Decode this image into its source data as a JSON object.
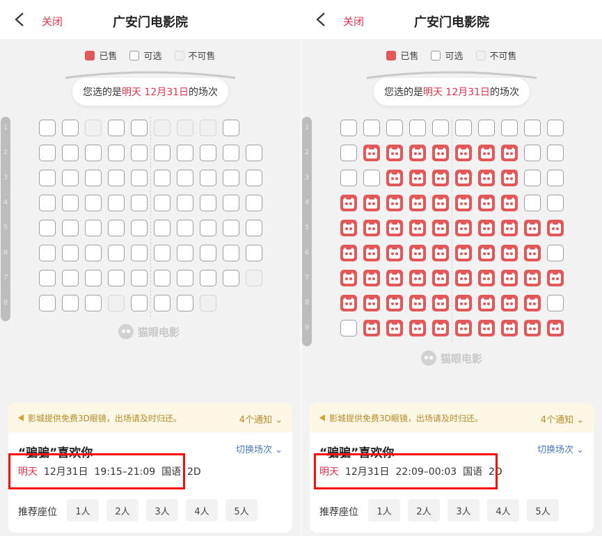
{
  "screens": [
    {
      "nav": {
        "close_label": "关闭",
        "title": "广安门电影院"
      },
      "legend": {
        "sold": "已售",
        "available": "可选",
        "not_for_sale": "不可售"
      },
      "session_pill": {
        "prefix": "您选的是",
        "day": "明天",
        "date": "12月31日",
        "suffix": "的场次"
      },
      "row_numbers": [
        "1",
        "2",
        "3",
        "4",
        "5",
        "6",
        "7",
        "8"
      ],
      "seat_rows": [
        [
          "A",
          "A",
          "N",
          "A",
          "A",
          "N",
          "N",
          "N",
          "A"
        ],
        [
          "A",
          "A",
          "A",
          "A",
          "A",
          "A",
          "A",
          "A",
          "A",
          "A"
        ],
        [
          "A",
          "A",
          "A",
          "A",
          "A",
          "A",
          "A",
          "A",
          "A",
          "A"
        ],
        [
          "A",
          "A",
          "A",
          "A",
          "A",
          "A",
          "A",
          "A",
          "A",
          "A"
        ],
        [
          "A",
          "A",
          "A",
          "A",
          "A",
          "A",
          "A",
          "A",
          "A",
          "A"
        ],
        [
          "A",
          "A",
          "A",
          "A",
          "A",
          "A",
          "A",
          "A",
          "A",
          "A"
        ],
        [
          "A",
          "A",
          "A",
          "A",
          "A",
          "A",
          "A",
          "A",
          "A",
          "N"
        ],
        [
          "A",
          "A",
          "A",
          "N",
          "A",
          "A",
          "A",
          "N"
        ]
      ],
      "watermark": "猫眼电影",
      "notice": {
        "text": "影城提供免费3D眼镜，出场请及时归还。",
        "count": "4个通知"
      },
      "movie": {
        "name": "“骗骗”喜欢你",
        "switch_label": "切换场次"
      },
      "showtime": {
        "day": "明天",
        "date": "12月31日",
        "time": "19:15–21:09",
        "language": "国语",
        "format": "2D"
      },
      "recommend": {
        "label": "推荐座位",
        "options": [
          "1人",
          "2人",
          "3人",
          "4人",
          "5人"
        ]
      }
    },
    {
      "nav": {
        "close_label": "关闭",
        "title": "广安门电影院"
      },
      "legend": {
        "sold": "已售",
        "available": "可选",
        "not_for_sale": "不可售"
      },
      "session_pill": {
        "prefix": "您选的是",
        "day": "明天",
        "date": "12月31日",
        "suffix": "的场次"
      },
      "row_numbers": [
        "1",
        "2",
        "3",
        "4",
        "5",
        "6",
        "7",
        "8",
        "9"
      ],
      "seat_rows": [
        [
          "A",
          "A",
          "A",
          "A",
          "A",
          "A",
          "A",
          "A",
          "A",
          "A"
        ],
        [
          "A",
          "S",
          "S",
          "S",
          "S",
          "S",
          "S",
          "S",
          "A",
          "A"
        ],
        [
          "A",
          "A",
          "S",
          "S",
          "S",
          "S",
          "S",
          "S",
          "A",
          "A"
        ],
        [
          "S",
          "S",
          "S",
          "S",
          "S",
          "S",
          "S",
          "S",
          "A",
          "A"
        ],
        [
          "S",
          "S",
          "S",
          "S",
          "S",
          "S",
          "S",
          "S",
          "S",
          "S"
        ],
        [
          "S",
          "S",
          "S",
          "S",
          "S",
          "S",
          "S",
          "S",
          "S",
          "A"
        ],
        [
          "S",
          "S",
          "S",
          "S",
          "S",
          "S",
          "S",
          "S",
          "S",
          "S"
        ],
        [
          "S",
          "S",
          "S",
          "S",
          "S",
          "S",
          "S",
          "S",
          "S",
          "A"
        ],
        [
          "A",
          "S",
          "S",
          "S",
          "S",
          "S",
          "S",
          "S",
          "S",
          "S"
        ]
      ],
      "watermark": "猫眼电影",
      "notice": {
        "text": "影城提供免费3D眼镜，出场请及时归还。",
        "count": "4个通知"
      },
      "movie": {
        "name": "“骗骗”喜欢你",
        "switch_label": "切换场次"
      },
      "showtime": {
        "day": "明天",
        "date": "12月31日",
        "time": "22:09–00:03",
        "language": "国语",
        "format": "2D"
      },
      "recommend": {
        "label": "推荐座位",
        "options": [
          "1人",
          "2人",
          "3人",
          "4人",
          "5人"
        ]
      }
    }
  ],
  "colors": {
    "accent_red": "#e1324a",
    "sold_seat": "#e25757",
    "link_blue": "#4a78c8",
    "notice_bg": "#fdf7e6",
    "highlight_box": "#ff0d0d"
  }
}
